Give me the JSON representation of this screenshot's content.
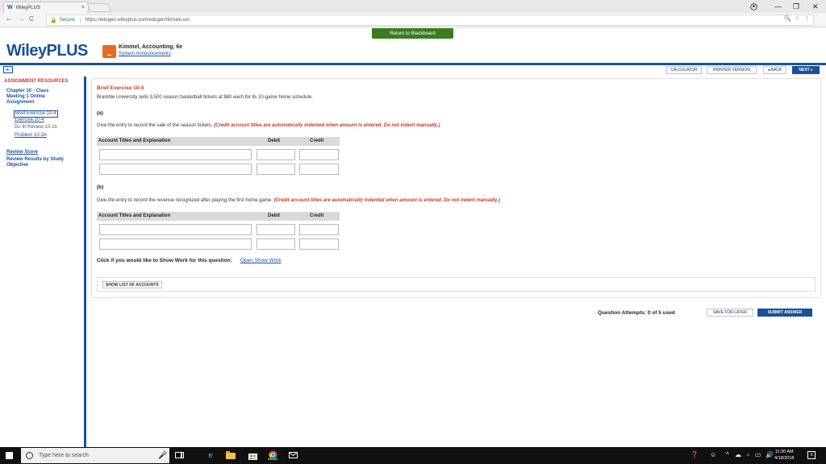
{
  "browser": {
    "tab_title": "WileyPLUS",
    "tab_close": "×",
    "secure_label": "Secure",
    "url": "https://edugen.wileyplus.com/edugen/lti/main.uni",
    "minimize": "—",
    "maximize": "❐",
    "close": "✕",
    "back": "←",
    "forward": "→",
    "reload": "C"
  },
  "header": {
    "return_button": "Return to Blackboard",
    "logo": "WileyPLUS",
    "book_title": "Kimmel, Accounting, 6e",
    "system_announcements": "System Announcements"
  },
  "toolbar": {
    "calculator": "CALCULATOR",
    "printer_version": "PRINTER VERSION",
    "back": "◂ BACK",
    "next": "NEXT ▸"
  },
  "sidebar": {
    "heading": "ASSIGNMENT RESOURCES",
    "assignment_link": [
      "Chapter 10 - Class",
      "Meeting 1 Online",
      "Assignment"
    ],
    "items": [
      "Brief Exercise 10-4",
      "Exercise 10-4",
      "Do It! Review 10-1b",
      "Problem 10-3A"
    ],
    "review_score": "Review Score",
    "review_results": [
      "Review Results by Study",
      "Objective"
    ]
  },
  "exercise": {
    "title": "Brief Exercise 10-4",
    "description": "Bramble University sells 3,500 season basketball tickets at $80 each for its 10-game home schedule.",
    "part_a": {
      "label": "(a)",
      "instruction": "Give the entry to record the sale of the season tickets. ",
      "note": "(Credit account titles are automatically indented when amount is entered. Do not indent manually.)"
    },
    "part_b": {
      "label": "(b)",
      "instruction": "Give the entry to record the revenue recognized after playing the first home game. ",
      "note": "(Credit account titles are automatically indented when amount is entered. Do not indent manually.)"
    },
    "table_headers": {
      "account": "Account Titles and Explanation",
      "debit": "Debit",
      "credit": "Credit"
    },
    "show_work_text": "Click if you would like to Show Work for this question:",
    "show_work_link": "Open Show Work",
    "list_accounts": "SHOW LIST OF ACCOUNTS"
  },
  "footer": {
    "attempts": "Question Attempts: 0 of 5 used",
    "save_later": "SAVE FOR LATER",
    "submit": "SUBMIT ANSWER"
  },
  "taskbar": {
    "search_placeholder": "Type here to search",
    "time": "11:30 AM",
    "date": "4/18/2018"
  }
}
